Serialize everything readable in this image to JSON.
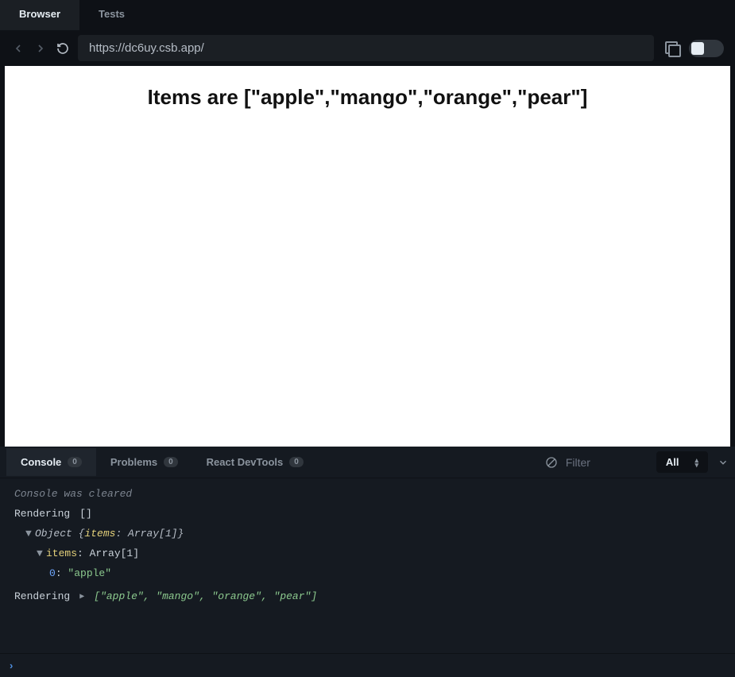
{
  "tabs": {
    "browser": "Browser",
    "tests": "Tests"
  },
  "url": "https://dc6uy.csb.app/",
  "preview": {
    "heading": "Items are [\"apple\",\"mango\",\"orange\",\"pear\"]"
  },
  "panel": {
    "tabs": {
      "console": {
        "label": "Console",
        "badge": "0"
      },
      "problems": {
        "label": "Problems",
        "badge": "0"
      },
      "react": {
        "label": "React DevTools",
        "badge": "0"
      }
    },
    "filter_placeholder": "Filter",
    "filter_select": "All"
  },
  "console": {
    "cleared": "Console was cleared",
    "render1_label": "Rendering",
    "render1_value": "[]",
    "obj_line": "Object {",
    "obj_items_key": "items",
    "obj_items_val": ": Array[1]}",
    "items_key": "items",
    "items_val": ": Array[1]",
    "idx0": "0",
    "idx0_sep": ": ",
    "idx0_val": "\"apple\"",
    "render2_label": "Rendering",
    "render2_arr_open": "[",
    "render2_items": [
      "\"apple\"",
      "\"mango\"",
      "\"orange\"",
      "\"pear\""
    ],
    "render2_arr_close": "]"
  }
}
